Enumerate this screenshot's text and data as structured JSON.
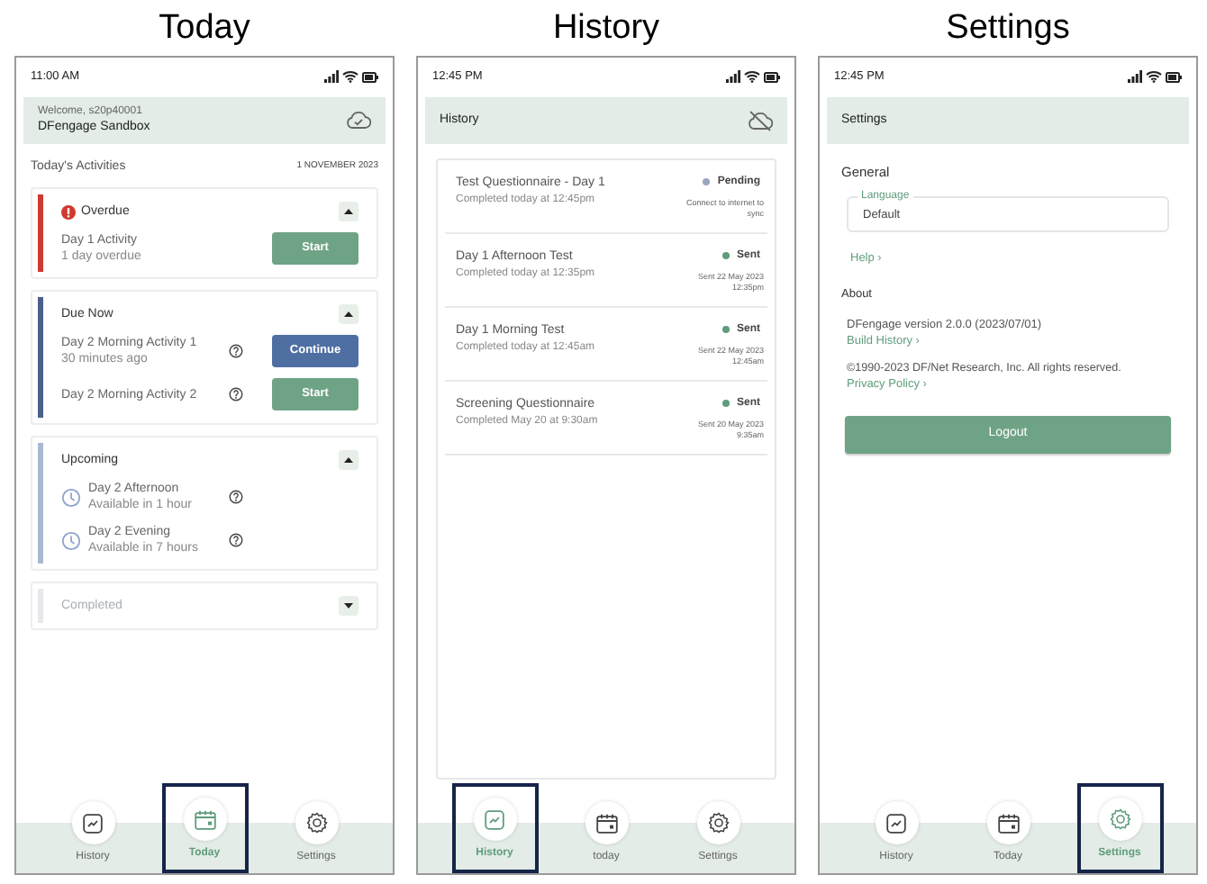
{
  "screens": [
    {
      "kind": "today",
      "heading": "Today",
      "time": "11:00 AM",
      "welcome": "Welcome, s20p40001",
      "app_name": "DFengage Sandbox",
      "section_title": "Today's Activities",
      "date": "1 NOVEMBER 2023",
      "groups": [
        {
          "title": "Overdue",
          "color": "#d0392f",
          "alert": true,
          "expanded": true,
          "disabled": false,
          "items": [
            {
              "kind": "activity",
              "name": "Day 1 Activity",
              "sub": "1 day overdue",
              "help": false,
              "action": {
                "kind": "start",
                "label": "Start"
              }
            }
          ]
        },
        {
          "title": "Due Now",
          "color": "#4b5f8c",
          "alert": false,
          "expanded": true,
          "disabled": false,
          "items": [
            {
              "kind": "activity",
              "name": "Day 2 Morning Activity 1",
              "sub": "30 minutes ago",
              "help": true,
              "action": {
                "kind": "continue",
                "label": "Continue"
              }
            },
            {
              "kind": "activity",
              "name": "Day 2 Morning Activity 2",
              "help": true,
              "action": {
                "kind": "start",
                "label": "Start"
              }
            }
          ]
        },
        {
          "title": "Upcoming",
          "color": "#aab8d2",
          "alert": false,
          "expanded": true,
          "disabled": false,
          "items": [
            {
              "kind": "upcoming",
              "name": "Day 2 Afternoon",
              "sub": "Available in 1 hour",
              "help": true
            },
            {
              "kind": "upcoming",
              "name": "Day 2 Evening",
              "sub": "Available in 7 hours",
              "help": true
            }
          ]
        },
        {
          "title": "Completed",
          "color": "#e6e8eb",
          "alert": false,
          "expanded": false,
          "disabled": true
        }
      ],
      "nav": [
        {
          "kind": "history",
          "label": "History",
          "selected": false
        },
        {
          "kind": "today",
          "label": "Today",
          "selected": true
        },
        {
          "kind": "settings",
          "label": "Settings",
          "selected": false
        }
      ]
    },
    {
      "kind": "history",
      "heading": "History",
      "time": "12:45 PM",
      "title": "History",
      "entries": [
        {
          "name": "Test Questionnaire - Day 1",
          "sub": "Completed today at 12:45pm",
          "status": "Pending",
          "color": "#9aa6bd",
          "note": "Connect to internet to sync"
        },
        {
          "name": "Day 1 Afternoon Test",
          "sub": "Completed today at 12:35pm",
          "status": "Sent",
          "color": "#5f9c7b",
          "note": "Sent 22 May 2023 12:35pm"
        },
        {
          "name": "Day 1 Morning Test",
          "sub": "Completed today at 12:45am",
          "status": "Sent",
          "color": "#5f9c7b",
          "note": "Sent 22 May 2023 12:45am"
        },
        {
          "name": "Screening Questionnaire",
          "sub": "Completed May 20 at 9:30am",
          "status": "Sent",
          "color": "#5f9c7b",
          "note": "Sent 20 May 2023 9:35am"
        }
      ],
      "nav": [
        {
          "kind": "history",
          "label": "History",
          "selected": true
        },
        {
          "kind": "today",
          "label": "today",
          "selected": false
        },
        {
          "kind": "settings",
          "label": "Settings",
          "selected": false
        }
      ]
    },
    {
      "kind": "settings",
      "heading": "Settings",
      "time": "12:45 PM",
      "title": "Settings",
      "general": "General",
      "field_label": "Language",
      "field_value": "Default",
      "help_link": "Help ›",
      "about": "About",
      "version": "DFengage version 2.0.0 (2023/07/01)",
      "build_link": "Build History ›",
      "copyright": "©1990-2023 DF/Net Research, Inc. All rights reserved.",
      "privacy_link": "Privacy Policy ›",
      "logout": "Logout",
      "nav": [
        {
          "kind": "history",
          "label": "History",
          "selected": false
        },
        {
          "kind": "today",
          "label": "Today",
          "selected": false
        },
        {
          "kind": "settings",
          "label": "Settings",
          "selected": true
        }
      ]
    }
  ]
}
